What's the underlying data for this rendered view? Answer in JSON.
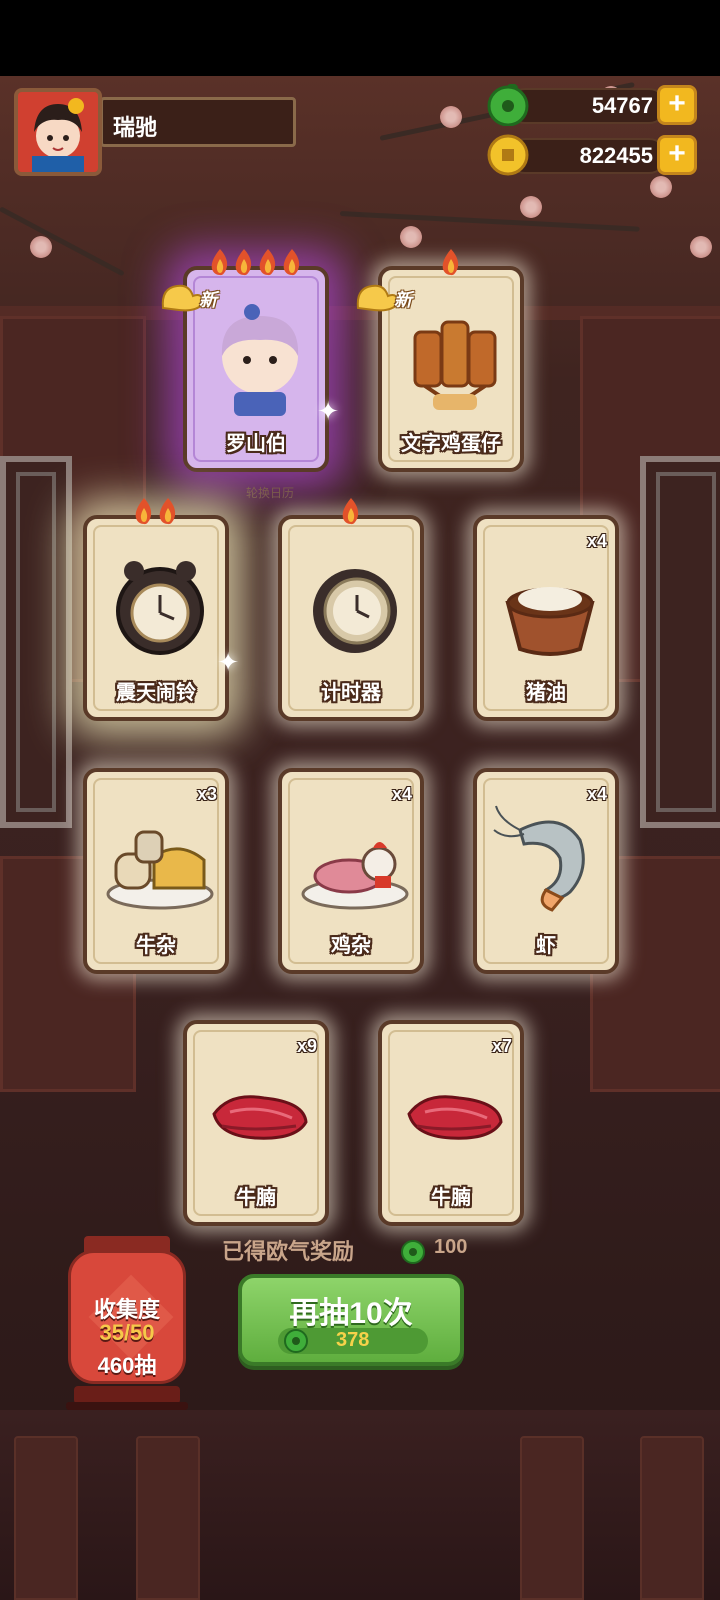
{
  "player": {
    "name": "瑞驰"
  },
  "currencies": {
    "jade": {
      "value": "54767",
      "icon": "jade-coin-icon"
    },
    "gold": {
      "value": "822455",
      "icon": "gold-coin-icon"
    }
  },
  "caption": "轮换日历",
  "new_tag": "新",
  "cards": [
    {
      "label": "罗山伯",
      "qty": "",
      "flames": 4,
      "new": true,
      "rarity": "purple"
    },
    {
      "label": "文字鸡蛋仔",
      "qty": "",
      "flames": 1,
      "new": true,
      "rarity": "normal"
    },
    {
      "label": "震天闹铃",
      "qty": "",
      "flames": 2,
      "new": false,
      "rarity": "glow"
    },
    {
      "label": "计时器",
      "qty": "",
      "flames": 1,
      "new": false,
      "rarity": "normal"
    },
    {
      "label": "猪油",
      "qty": "x4",
      "flames": 0,
      "new": false,
      "rarity": "normal"
    },
    {
      "label": "牛杂",
      "qty": "x3",
      "flames": 0,
      "new": false,
      "rarity": "normal"
    },
    {
      "label": "鸡杂",
      "qty": "x4",
      "flames": 0,
      "new": false,
      "rarity": "normal"
    },
    {
      "label": "虾",
      "qty": "x4",
      "flames": 0,
      "new": false,
      "rarity": "normal"
    },
    {
      "label": "牛腩",
      "qty": "x9",
      "flames": 0,
      "new": false,
      "rarity": "normal"
    },
    {
      "label": "牛腩",
      "qty": "x7",
      "flames": 0,
      "new": false,
      "rarity": "normal"
    }
  ],
  "reward": {
    "label": "已得欧气奖励",
    "value": "100"
  },
  "collection": {
    "title": "收集度",
    "progress": "35/50",
    "draws": "460抽"
  },
  "draw_button": {
    "label": "再抽10次",
    "cost": "378"
  },
  "colors": {
    "accent_green": "#5fae3e",
    "gold": "#f2b81f",
    "purple_glow": "#c850ff"
  }
}
